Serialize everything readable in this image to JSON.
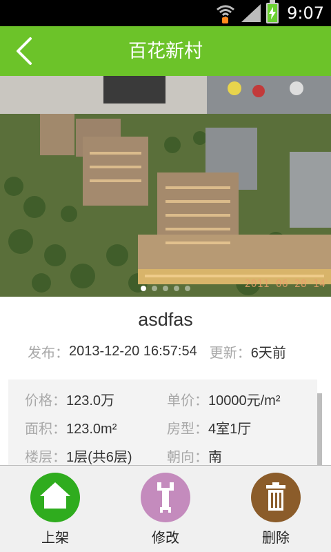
{
  "status_bar": {
    "time": "9:07",
    "icons": [
      "wifi-icon",
      "sync-icon",
      "signal-icon",
      "battery-charging-icon"
    ]
  },
  "header": {
    "title": "百花新村",
    "back_icon": "chevron-left-icon"
  },
  "photo": {
    "timestamp": "2011 06 28 14",
    "pages": 5,
    "active_page": 1
  },
  "listing": {
    "name": "asdfas",
    "published_label": "发布",
    "published_value": "2013-12-20 16:57:54",
    "updated_label": "更新",
    "updated_value": "6天前",
    "separator": "："
  },
  "details": [
    [
      {
        "label": "价格",
        "value": "123.0万"
      },
      {
        "label": "单价",
        "value": "10000元/m²"
      }
    ],
    [
      {
        "label": "面积",
        "value": "123.0m²"
      },
      {
        "label": "房型",
        "value": "4室1厅"
      }
    ],
    [
      {
        "label": "楼层",
        "value": "1层(共6层)"
      },
      {
        "label": "朝向",
        "value": "南"
      }
    ]
  ],
  "actions": [
    {
      "label": "上架",
      "icon": "home-icon",
      "color": "#2fac1e"
    },
    {
      "label": "修改",
      "icon": "wrench-icon",
      "color": "#c48bbd"
    },
    {
      "label": "删除",
      "icon": "trash-icon",
      "color": "#8b5c2a"
    }
  ],
  "colors": {
    "accent": "#6cc329",
    "status_bar": "#000000",
    "label_gray": "#a8a8a8"
  }
}
